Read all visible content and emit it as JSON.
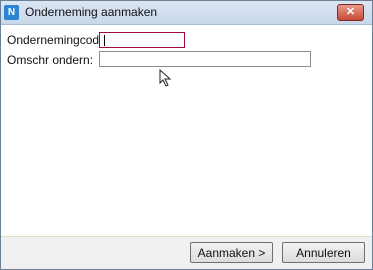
{
  "window": {
    "title": "Onderneming aanmaken",
    "app_icon": "app-logo-icon",
    "close_label": "✕"
  },
  "form": {
    "code_label": "Ondernemingcode:",
    "code_value": "",
    "description_label": "Omschr ondern:",
    "description_value": ""
  },
  "footer": {
    "create_label": "Aanmaken >",
    "cancel_label": "Annuleren"
  },
  "colors": {
    "focused_border": "#9e0e34",
    "close_button": "#c64a36",
    "app_icon": "#2f83d3"
  }
}
